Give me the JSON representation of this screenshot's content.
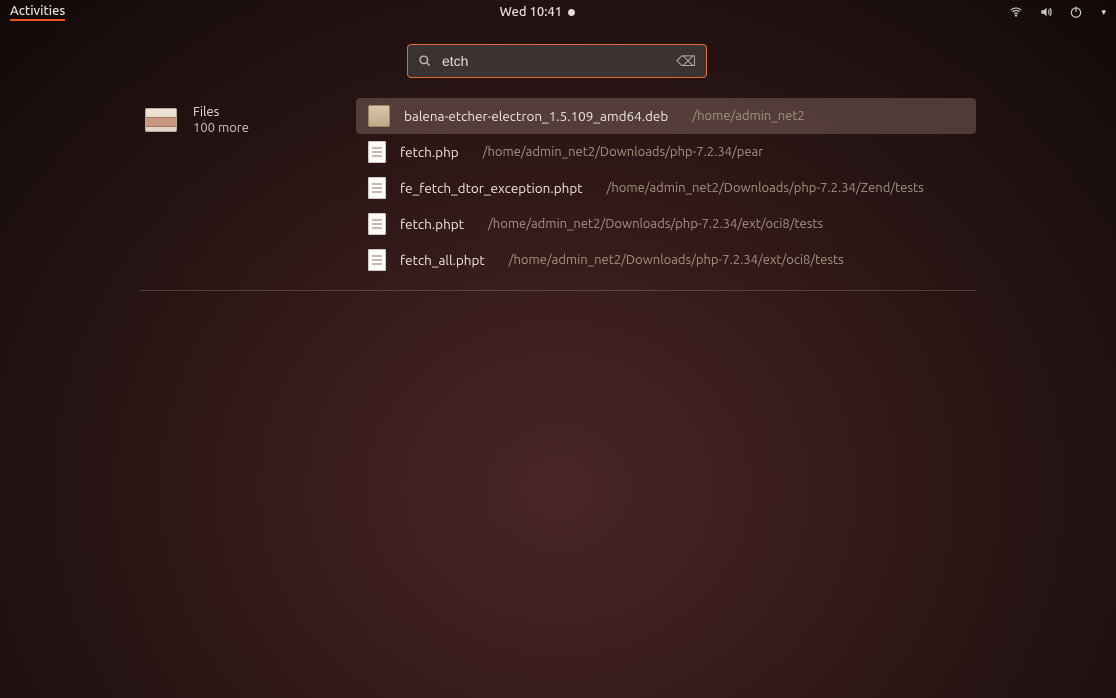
{
  "topbar": {
    "activities": "Activities",
    "clock": "Wed 10:41"
  },
  "search": {
    "query": "etch",
    "clear_label": "⌫"
  },
  "category": {
    "title": "Files",
    "subtitle": "100 more"
  },
  "results": [
    {
      "icon": "pkg",
      "name": "balena-etcher-electron_1.5.109_amd64.deb",
      "path": "/home/admin_net2",
      "selected": true
    },
    {
      "icon": "file",
      "name": "fetch.php",
      "path": "/home/admin_net2/Downloads/php-7.2.34/pear",
      "selected": false
    },
    {
      "icon": "file",
      "name": "fe_fetch_dtor_exception.phpt",
      "path": "/home/admin_net2/Downloads/php-7.2.34/Zend/tests",
      "selected": false
    },
    {
      "icon": "file",
      "name": "fetch.phpt",
      "path": "/home/admin_net2/Downloads/php-7.2.34/ext/oci8/tests",
      "selected": false
    },
    {
      "icon": "file",
      "name": "fetch_all.phpt",
      "path": "/home/admin_net2/Downloads/php-7.2.34/ext/oci8/tests",
      "selected": false
    }
  ]
}
